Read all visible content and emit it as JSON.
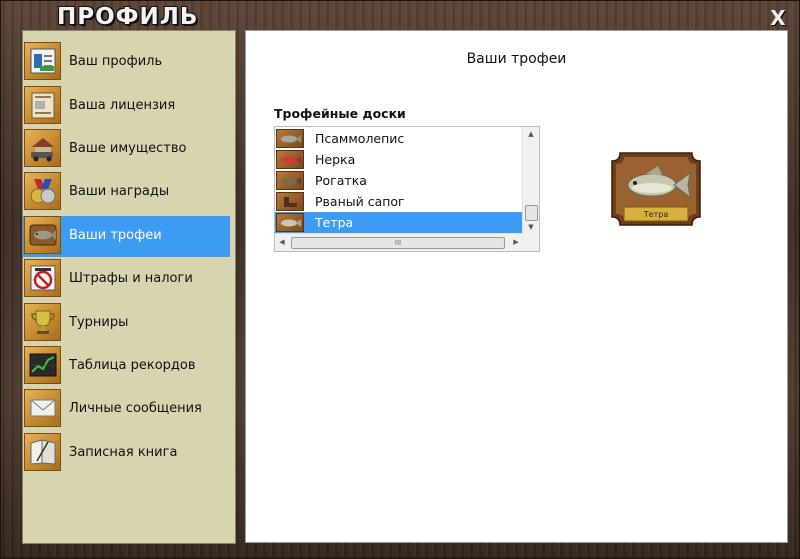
{
  "window": {
    "title": "ПРОФИЛЬ",
    "close_label": "X"
  },
  "sidebar": {
    "items": [
      {
        "label": "Ваш профиль",
        "icon": "profile-icon"
      },
      {
        "label": "Ваша лицензия",
        "icon": "license-icon"
      },
      {
        "label": "Ваше имущество",
        "icon": "property-icon"
      },
      {
        "label": "Ваши награды",
        "icon": "medal-icon"
      },
      {
        "label": "Ваши трофеи",
        "icon": "trophy-fish-icon",
        "active": true
      },
      {
        "label": "Штрафы и налоги",
        "icon": "fine-icon"
      },
      {
        "label": "Турниры",
        "icon": "cup-icon"
      },
      {
        "label": "Таблица рекордов",
        "icon": "chart-icon"
      },
      {
        "label": "Личные сообщения",
        "icon": "envelope-icon"
      },
      {
        "label": "Записная книга",
        "icon": "notebook-icon"
      }
    ]
  },
  "main": {
    "title": "Ваши трофеи",
    "list_heading": "Трофейные доски",
    "list": [
      {
        "label": "Псаммолепис"
      },
      {
        "label": "Нерка"
      },
      {
        "label": "Рогатка"
      },
      {
        "label": "Рваный сапог"
      },
      {
        "label": "Тетра",
        "selected": true
      }
    ],
    "hscroll_grip": "III",
    "plaque_label": "Тетра"
  },
  "colors": {
    "selection": "#3d9bf4",
    "sidebar_bg": "#d8d4b0",
    "wood": "#4a372c"
  }
}
